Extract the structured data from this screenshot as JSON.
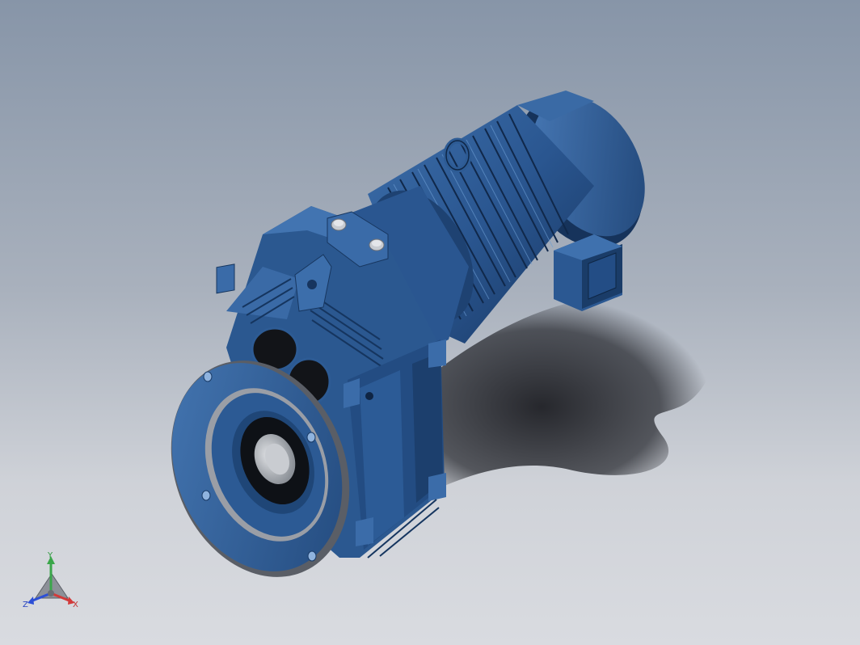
{
  "viewport": {
    "background_top": "#8795a8",
    "background_bottom": "#d9dbe0",
    "model_color": "#2f5e96",
    "model_dark": "#1a3a64",
    "steel_color": "#b8bcc2"
  },
  "triad": {
    "y_label": "Y",
    "x_label": "X",
    "z_label": "Z",
    "y_color": "#3aa64a",
    "x_color": "#d23a3a",
    "z_color": "#2c4fd6"
  }
}
